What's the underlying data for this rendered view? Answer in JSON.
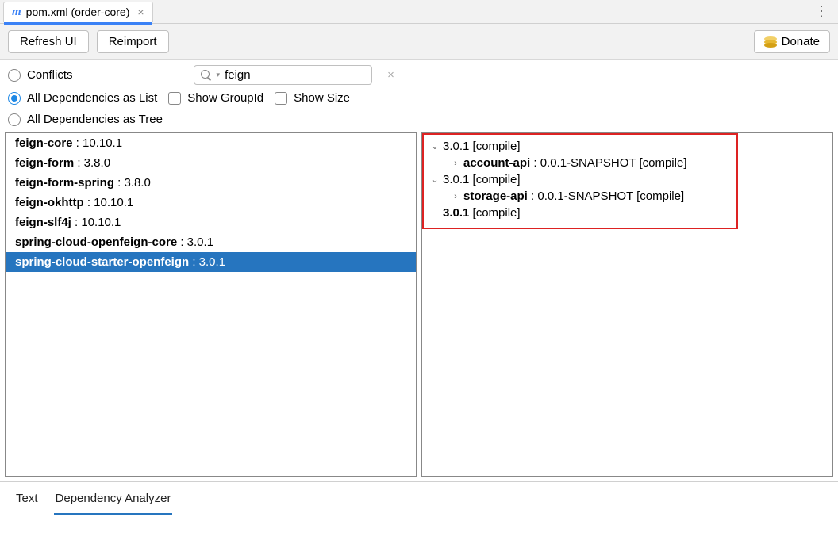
{
  "tab": {
    "icon_letter": "m",
    "title": "pom.xml (order-core)"
  },
  "toolbar": {
    "refresh_label": "Refresh UI",
    "reimport_label": "Reimport",
    "donate_label": "Donate"
  },
  "filters": {
    "conflicts_label": "Conflicts",
    "all_list_label": "All Dependencies as List",
    "all_tree_label": "All Dependencies as Tree",
    "show_groupid_label": "Show GroupId",
    "show_size_label": "Show Size"
  },
  "search": {
    "value": "feign"
  },
  "dependencies": [
    {
      "name": "feign-core",
      "version": "10.10.1"
    },
    {
      "name": "feign-form",
      "version": "3.8.0"
    },
    {
      "name": "feign-form-spring",
      "version": "3.8.0"
    },
    {
      "name": "feign-okhttp",
      "version": "10.10.1"
    },
    {
      "name": "feign-slf4j",
      "version": "10.10.1"
    },
    {
      "name": "spring-cloud-openfeign-core",
      "version": "3.0.1"
    },
    {
      "name": "spring-cloud-starter-openfeign",
      "version": "3.0.1"
    }
  ],
  "selected_dependency_index": 6,
  "tree": [
    {
      "level": 0,
      "expanded": true,
      "text": "3.0.1 [compile]",
      "bold_name": ""
    },
    {
      "level": 1,
      "expanded": false,
      "text": " : 0.0.1-SNAPSHOT [compile]",
      "bold_name": "account-api"
    },
    {
      "level": 0,
      "expanded": true,
      "text": "3.0.1 [compile]",
      "bold_name": ""
    },
    {
      "level": 1,
      "expanded": false,
      "text": " : 0.0.1-SNAPSHOT [compile]",
      "bold_name": "storage-api"
    },
    {
      "level": 0,
      "expanded": false,
      "leaf": true,
      "text": " [compile]",
      "bold_name": "3.0.1"
    }
  ],
  "bottom_tabs": {
    "text_label": "Text",
    "analyzer_label": "Dependency Analyzer"
  }
}
